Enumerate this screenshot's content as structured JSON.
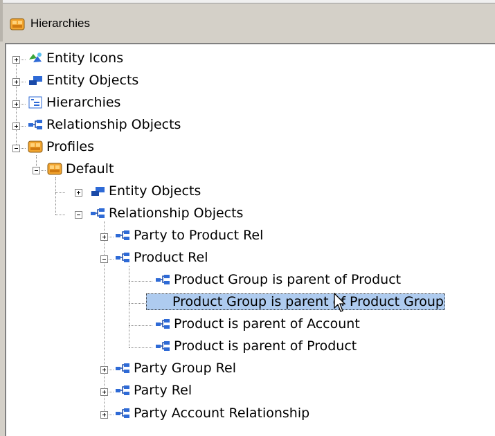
{
  "window": {
    "title": "Hierarchies",
    "title_icon": "profile-cube-icon"
  },
  "tree": {
    "entity_icons": "Entity Icons",
    "entity_objects": "Entity Objects",
    "hierarchies": "Hierarchies",
    "relationship_objects": "Relationship Objects",
    "profiles": "Profiles",
    "default": "Default",
    "default_entity_objects": "Entity Objects",
    "default_relationship_objects": "Relationship Objects",
    "party_to_product_rel": "Party to Product Rel",
    "product_rel": "Product Rel",
    "pg_parent_product": "Product Group is parent of Product",
    "pg_parent_pg": "Product Group is parent of Product Group",
    "p_parent_account": "Product is parent of Account",
    "p_parent_product": "Product is parent of Product",
    "party_group_rel": "Party Group Rel",
    "party_rel": "Party Rel",
    "party_account_relationship": "Party Account Relationship"
  },
  "selected_item": "Product Group is parent of Product Group",
  "colors": {
    "selection": "#aecbef",
    "chrome": "#d4d0c8",
    "icon_blue": "#2e6ad6",
    "icon_orange": "#f0a020"
  }
}
